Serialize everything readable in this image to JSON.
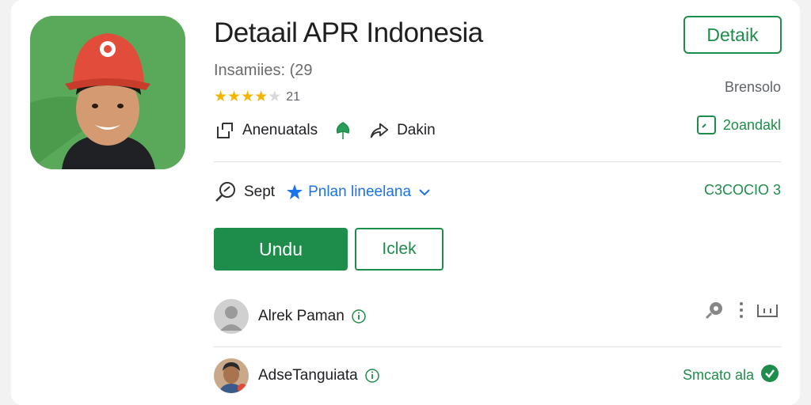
{
  "app": {
    "title": "Detaail APR Indonesia",
    "subtitle": "Insamiies: (29",
    "rating_value": 3.5,
    "rating_count": "21",
    "meta_item_1": "Anenuatals",
    "meta_item_2": "Dakin"
  },
  "actions": {
    "detail_button": "Detaik",
    "right_label_1": "Brensolo",
    "right_label_2": "2oandakl",
    "right_label_3": "C3COCIO 3",
    "install_button": "Undu",
    "secondary_button": "Iclek"
  },
  "tags": {
    "primary": "Sept",
    "secondary": "Pnlan lineelana"
  },
  "reviews": [
    {
      "name": "Alrek Paman"
    },
    {
      "name": "AdseTanguiata",
      "status": "Smcato ala"
    }
  ],
  "colors": {
    "accent": "#1e8c4a",
    "link": "#1a73e8",
    "star": "#f5b400"
  },
  "icons": [
    "edit-icon",
    "leaf-pin-icon",
    "share-icon",
    "checkbox-icon",
    "search-tag-icon",
    "star-icon",
    "chevron-down-icon",
    "info-icon",
    "search-gear-icon",
    "more-vert-icon",
    "flag-icon",
    "check-circle-icon"
  ]
}
